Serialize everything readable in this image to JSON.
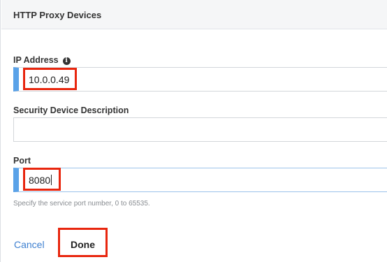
{
  "header": {
    "title": "HTTP Proxy Devices"
  },
  "form": {
    "ip_address": {
      "label": "IP Address",
      "value": "10.0.0.49",
      "info_icon": "info-icon"
    },
    "description": {
      "label": "Security Device Description",
      "value": ""
    },
    "port": {
      "label": "Port",
      "value": "8080",
      "hint": "Specify the service port number, 0 to 65535."
    }
  },
  "actions": {
    "cancel_label": "Cancel",
    "done_label": "Done"
  },
  "colors": {
    "required_accent": "#5aa2e8",
    "link": "#3d7fd0",
    "annotation": "#e8260e"
  }
}
